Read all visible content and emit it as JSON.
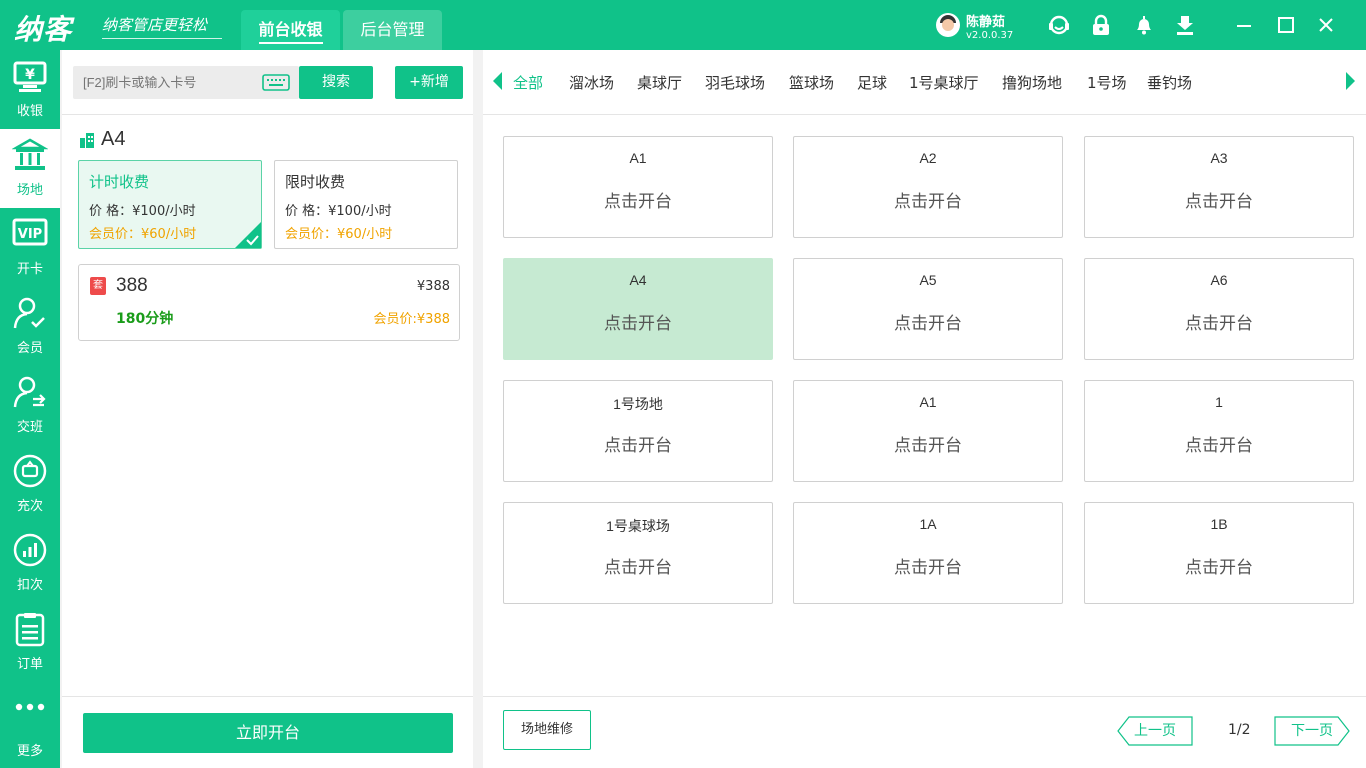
{
  "app": {
    "logo": "纳客",
    "slogan": "纳客管店更轻松",
    "tabs": [
      {
        "label": "前台收银",
        "active": true
      },
      {
        "label": "后台管理",
        "active": false
      }
    ],
    "user": {
      "name": "陈静茹",
      "version": "v2.0.0.37"
    },
    "accent_color": "#10c289"
  },
  "leftnav": [
    {
      "label": "收银",
      "icon": "cashier-icon"
    },
    {
      "label": "场地",
      "icon": "venue-icon",
      "active": true
    },
    {
      "label": "开卡",
      "icon": "vip-card-icon"
    },
    {
      "label": "会员",
      "icon": "member-icon"
    },
    {
      "label": "交班",
      "icon": "shift-icon"
    },
    {
      "label": "充次",
      "icon": "recharge-icon"
    },
    {
      "label": "扣次",
      "icon": "deduct-icon"
    },
    {
      "label": "订单",
      "icon": "order-icon"
    },
    {
      "label": "更多",
      "icon": "more-icon"
    }
  ],
  "mid": {
    "search_placeholder": "[F2]刷卡或输入卡号",
    "search_button": "搜索",
    "add_button": "+新增",
    "selected_venue": "A4",
    "plans": [
      {
        "title": "计时收费",
        "price": "价 格：¥100/小时",
        "member_price": "会员价：¥60/小时",
        "selected": true
      },
      {
        "title": "限时收费",
        "price": "价 格：¥100/小时",
        "member_price": "会员价：¥60/小时",
        "selected": false
      }
    ],
    "package": {
      "badge": "套",
      "name": "388",
      "price": "¥388",
      "duration": "180分钟",
      "member_price": "会员价:¥388"
    },
    "open_button": "立即开台"
  },
  "right": {
    "categories": [
      "全部",
      "溜冰场",
      "桌球厅",
      "羽毛球场",
      "篮球场",
      "足球",
      "1号桌球厅",
      "撸狗场地",
      "1号场",
      "垂钓场"
    ],
    "active_category": 0,
    "courts": [
      {
        "name": "A1",
        "action": "点击开台"
      },
      {
        "name": "A2",
        "action": "点击开台"
      },
      {
        "name": "A3",
        "action": "点击开台"
      },
      {
        "name": "A4",
        "action": "点击开台",
        "selected": true
      },
      {
        "name": "A5",
        "action": "点击开台"
      },
      {
        "name": "A6",
        "action": "点击开台"
      },
      {
        "name": "1号场地",
        "action": "点击开台"
      },
      {
        "name": "A1",
        "action": "点击开台"
      },
      {
        "name": "1",
        "action": "点击开台"
      },
      {
        "name": "1号桌球场",
        "action": "点击开台"
      },
      {
        "name": "1A",
        "action": "点击开台"
      },
      {
        "name": "1B",
        "action": "点击开台"
      }
    ],
    "repair_button": "场地维修",
    "prev_page": "上一页",
    "next_page": "下一页",
    "page": "1/2"
  }
}
